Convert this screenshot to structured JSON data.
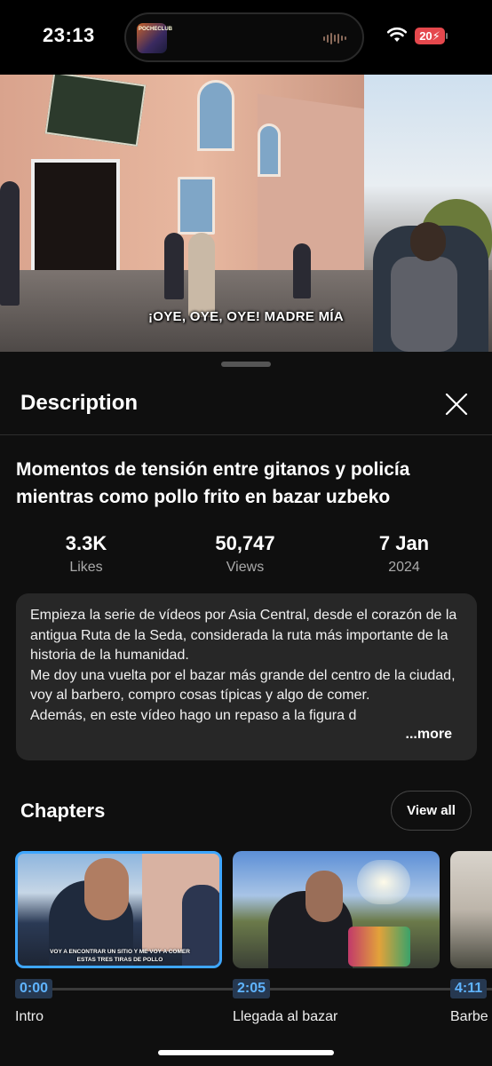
{
  "status_bar": {
    "time": "23:13",
    "battery": "20",
    "island_app_label": "POCHECLUB"
  },
  "video": {
    "subtitle": "¡OYE, OYE, OYE! MADRE MÍA"
  },
  "sheet": {
    "title": "Description",
    "video_title": "Momentos de tensión entre gitanos y policía mientras como pollo frito en bazar uzbeko",
    "stats": [
      {
        "value": "3.3K",
        "label": "Likes"
      },
      {
        "value": "50,747",
        "label": "Views"
      },
      {
        "value": "7 Jan",
        "label": "2024"
      }
    ],
    "description": "Empieza la serie de vídeos por Asia Central, desde el corazón de la antigua Ruta de la Seda, considerada la ruta más importante de la historia de la humanidad.\nMe doy una vuelta por el bazar más grande del centro de la ciudad, voy al barbero, compro cosas típicas y algo de comer.\nAdemás, en este vídeo hago un repaso a la figura d",
    "more_label": "...more"
  },
  "chapters": {
    "title": "Chapters",
    "view_all": "View all",
    "items": [
      {
        "time": "0:00",
        "label": "Intro",
        "caption": "VOY A ENCONTRAR UN SITIO Y ME VOY A COMER ESTAS TRES TIRAS DE POLLO"
      },
      {
        "time": "2:05",
        "label": "Llegada al bazar"
      },
      {
        "time": "4:11",
        "label": "Barbe"
      }
    ]
  },
  "colors": {
    "accent": "#3ea6ff",
    "battery": "#e5484d"
  }
}
